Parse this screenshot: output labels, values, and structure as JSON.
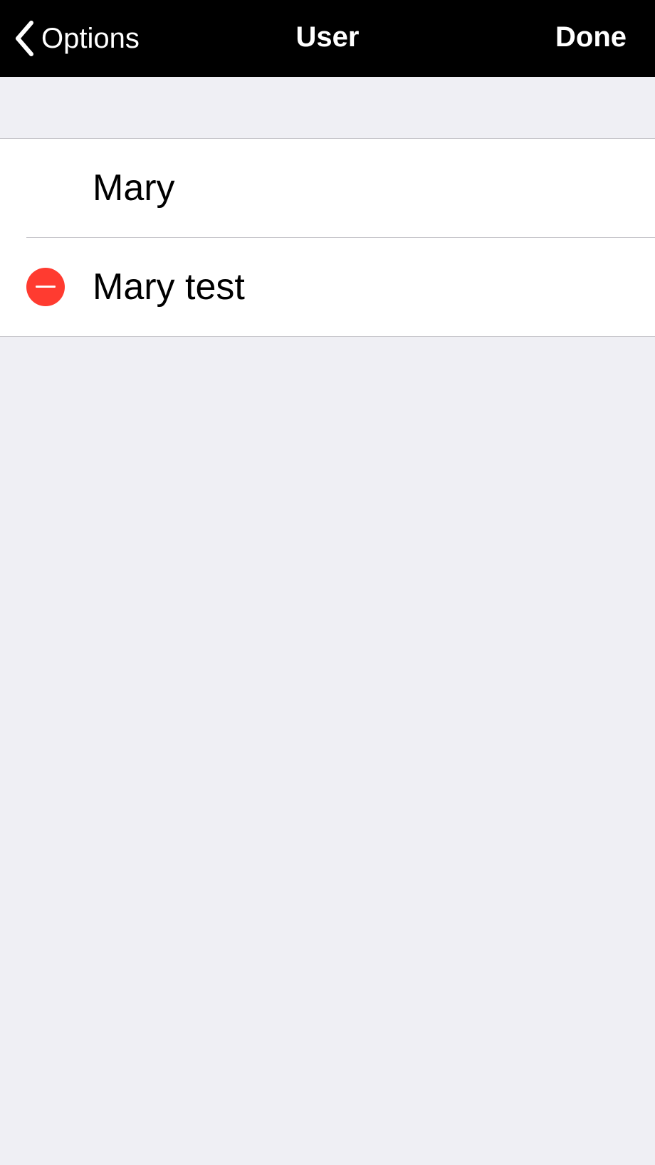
{
  "navbar": {
    "back_label": "Options",
    "title": "User",
    "done_label": "Done"
  },
  "users": [
    {
      "name": "Mary"
    },
    {
      "name": "Mary test"
    }
  ],
  "colors": {
    "navbar_background": "#000000",
    "page_background": "#efeff4",
    "delete_control": "#ff3b30",
    "separator": "#c8c7cc"
  },
  "icons": {
    "back": "chevron-left-icon",
    "delete": "minus-circle-icon"
  }
}
